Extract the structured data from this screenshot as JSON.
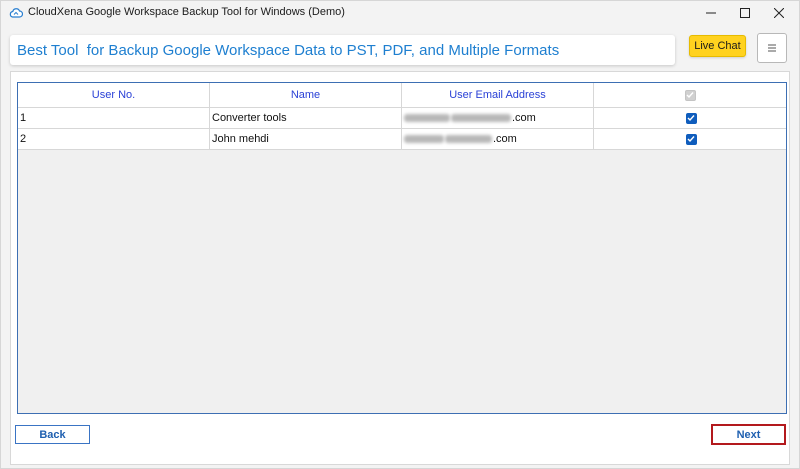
{
  "window": {
    "title": "CloudXena Google Workspace Backup Tool for Windows (Demo)",
    "controls": [
      "minimize-icon",
      "maximize-icon",
      "close-icon"
    ]
  },
  "banner": {
    "text": "Best Tool  for Backup Google Workspace Data to PST, PDF, and Multiple Formats"
  },
  "header_buttons": {
    "live_chat": "Live Chat",
    "menu_icon": "hamburger-menu-icon"
  },
  "table": {
    "columns": [
      "User No.",
      "Name",
      "User Email Address",
      ""
    ],
    "header_checkbox_checked": true,
    "rows": [
      {
        "no": "1",
        "name": "Converter tools",
        "email_suffix": ".com",
        "checked": true
      },
      {
        "no": "2",
        "name": "John mehdi",
        "email_suffix": ".com",
        "checked": true
      }
    ]
  },
  "footer": {
    "back_label": "Back",
    "next_label": "Next"
  },
  "colors": {
    "accent": "#1e7fd0",
    "header_text": "#2a41d6",
    "live_chat_bg": "#ffd21f",
    "next_border": "#b3191d",
    "checkbox": "#0f5dbd"
  }
}
